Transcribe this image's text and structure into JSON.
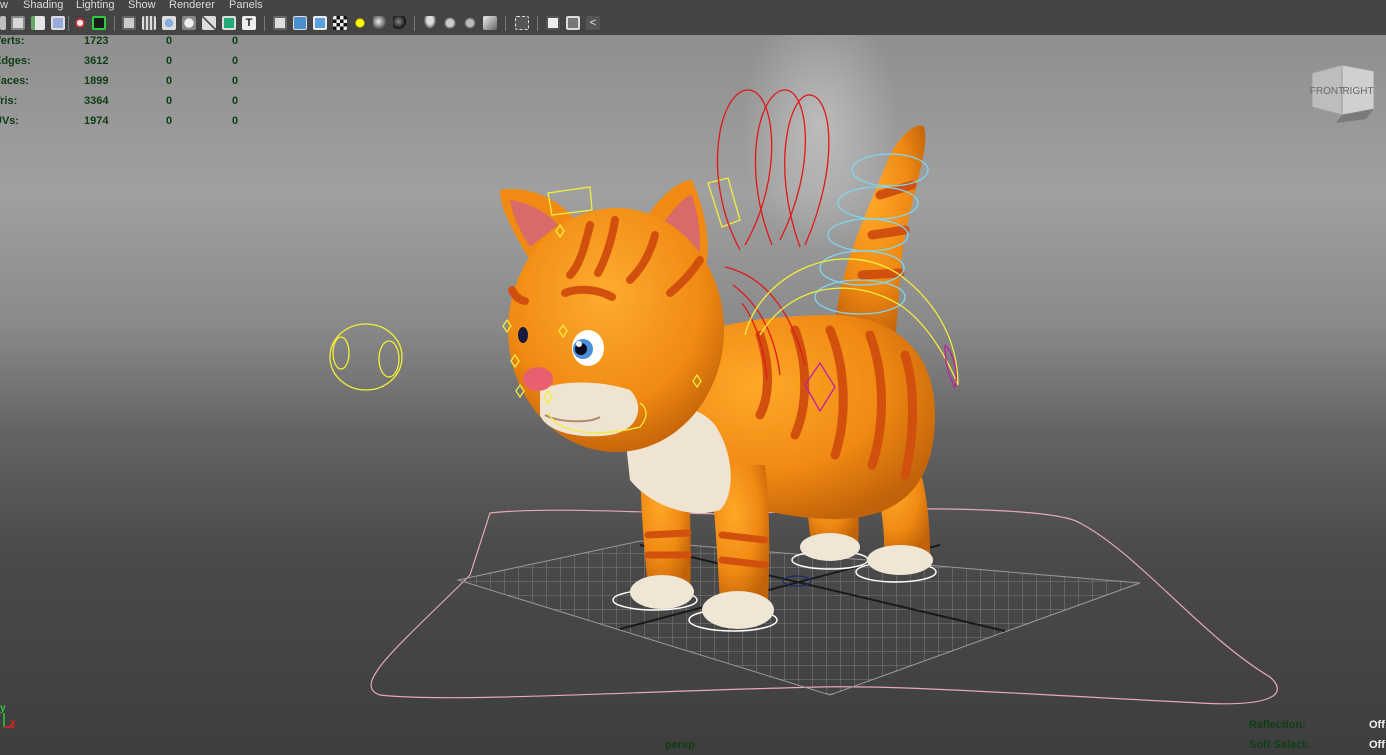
{
  "menu": [
    "w",
    "Shading",
    "Lighting",
    "Show",
    "Renderer",
    "Panels"
  ],
  "hud": {
    "rows": [
      {
        "label": "Verts:",
        "v1": "1723",
        "v2": "0",
        "v3": "0"
      },
      {
        "label": "Edges:",
        "v1": "3612",
        "v2": "0",
        "v3": "0"
      },
      {
        "label": "Faces:",
        "v1": "1899",
        "v2": "0",
        "v3": "0"
      },
      {
        "label": "Tris:",
        "v1": "3364",
        "v2": "0",
        "v3": "0"
      },
      {
        "label": "UVs:",
        "v1": "1974",
        "v2": "0",
        "v3": "0"
      }
    ],
    "reflection_label": "Reflection:",
    "reflection_value": "Off",
    "soft_select_label": "Soft Select:",
    "soft_select_value": "Off"
  },
  "viewcube": {
    "front": "FRONT",
    "right": "RIGHT"
  },
  "camera": "persp",
  "axis": {
    "y": "y",
    "x": "x"
  },
  "colors": {
    "hud_text": "#0d3d12",
    "cat_orange": "#f08a12",
    "stripe": "#d2500e",
    "control_red": "#e01818",
    "control_yellow": "#f2ee3a",
    "control_cyan": "#7fd6f0",
    "control_magenta": "#c020a0",
    "ground_curve": "#e8a8b4"
  }
}
